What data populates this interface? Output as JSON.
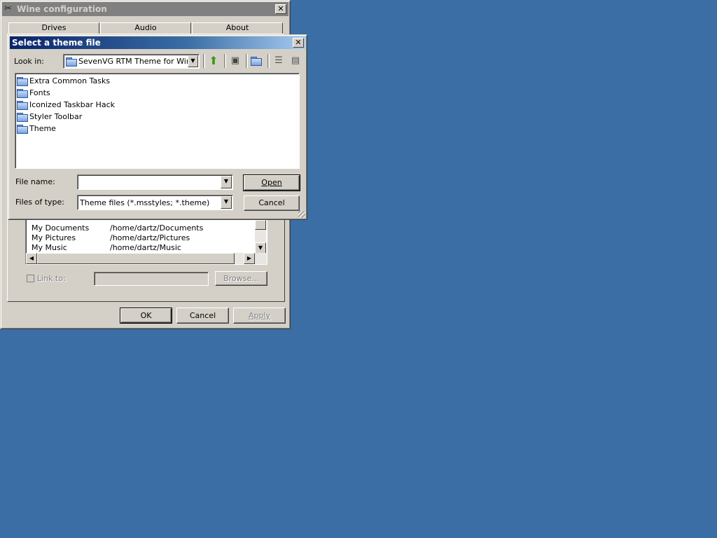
{
  "wine": {
    "title": "Wine configuration",
    "tabs": [
      "Drives",
      "Audio",
      "About"
    ],
    "drives": [
      {
        "name": "My Documents",
        "path": "/home/dartz/Documents"
      },
      {
        "name": "My Pictures",
        "path": "/home/dartz/Pictures"
      },
      {
        "name": "My Music",
        "path": "/home/dartz/Music"
      }
    ],
    "link_to_label": "Link to:",
    "link_to_value": "",
    "browse_label": "Browse...",
    "ok_label": "OK",
    "cancel_label": "Cancel",
    "apply_label": "Apply"
  },
  "dialog": {
    "title": "Select a theme file",
    "look_in_label": "Look in:",
    "look_in_value": "SevenVG RTM Theme for Windows",
    "toolbar_icons": [
      "up-folder-icon",
      "desktop-icon",
      "new-folder-icon",
      "list-view-icon",
      "details-view-icon"
    ],
    "files": [
      {
        "name": "Extra Common Tasks",
        "icon": "folder-icon"
      },
      {
        "name": "Fonts",
        "icon": "folder-icon"
      },
      {
        "name": "Iconized Taskbar Hack",
        "icon": "folder-icon"
      },
      {
        "name": "Styler Toolbar",
        "icon": "folder-icon"
      },
      {
        "name": "Theme",
        "icon": "folder-icon"
      }
    ],
    "file_name_label": "File name:",
    "file_name_value": "",
    "files_of_type_label": "Files of type:",
    "files_of_type_value": "Theme files (*.msstyles; *.theme)",
    "open_label": "Open",
    "cancel_label": "Cancel"
  },
  "colors": {
    "desktop": "#3a6ea5",
    "window_face": "#d4d0c8",
    "active_title_start": "#0a246a",
    "inactive_title": "#808080"
  }
}
